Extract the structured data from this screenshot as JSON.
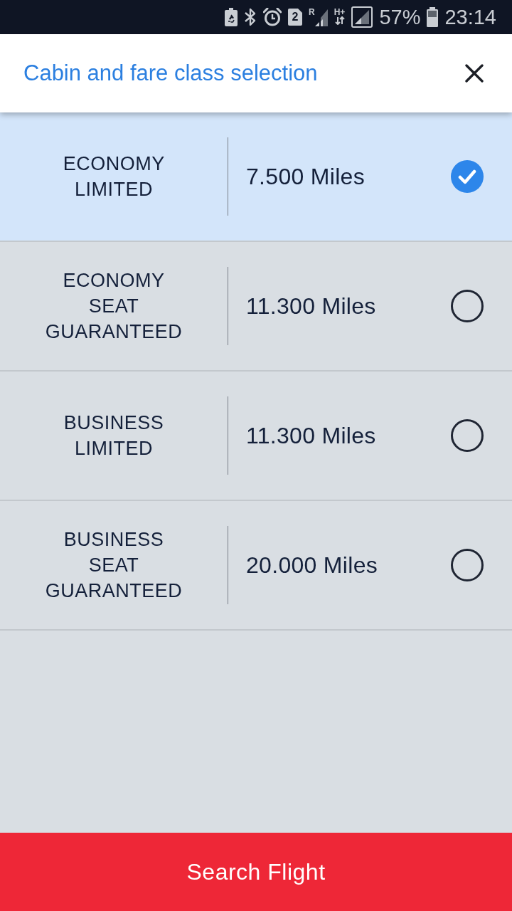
{
  "status_bar": {
    "sim_slot": "2",
    "roaming": "R",
    "network": "H+",
    "battery": "57%",
    "time": "23:14"
  },
  "header": {
    "title": "Cabin and fare class selection"
  },
  "fares": [
    {
      "label": "ECONOMY LIMITED",
      "miles": "7.500 Miles",
      "selected": true
    },
    {
      "label": "ECONOMY SEAT GUARANTEED",
      "miles": "11.300 Miles",
      "selected": false
    },
    {
      "label": "BUSINESS LIMITED",
      "miles": "11.300 Miles",
      "selected": false
    },
    {
      "label": "BUSINESS SEAT GUARANTEED",
      "miles": "20.000 Miles",
      "selected": false
    }
  ],
  "action": {
    "label": "Search Flight"
  }
}
